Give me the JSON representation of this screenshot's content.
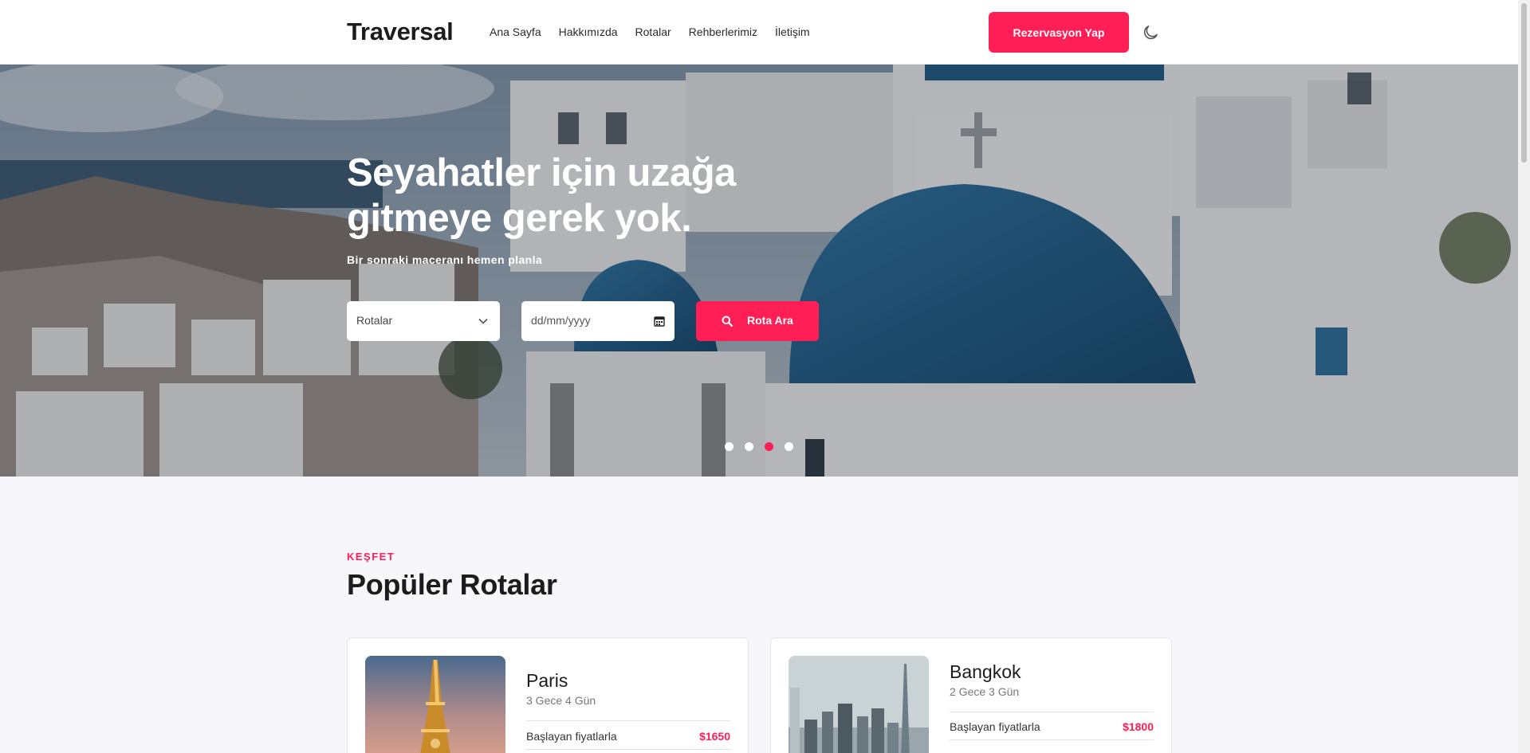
{
  "header": {
    "brand": "Traversal",
    "nav": [
      "Ana Sayfa",
      "Hakkımızda",
      "Rotalar",
      "Rehberlerimiz",
      "İletişim"
    ],
    "reserve_label": "Rezervasyon Yap",
    "theme_icon": "moon-icon"
  },
  "hero": {
    "title": "Seyahatler için uzağa gitmeye gerek yok.",
    "subtitle": "Bir sonraki maceranı hemen planla",
    "route_select_value": "Rotalar",
    "date_placeholder": "dd/mm/yyyy",
    "search_label": "Rota Ara",
    "carousel_dot_count": 4,
    "carousel_active_index": 2
  },
  "popular": {
    "kicker": "KEŞFET",
    "title": "Popüler Rotalar",
    "cards": [
      {
        "name": "Paris",
        "duration": "3 Gece 4 Gün",
        "price_label": "Başlayan fiyatlarla",
        "price": "$1650"
      },
      {
        "name": "Bangkok",
        "duration": "2 Gece 3 Gün",
        "price_label": "Başlayan fiyatlarla",
        "price": "$1800"
      }
    ]
  },
  "colors": {
    "accent": "#ff1e56",
    "background": "#f6f6fb",
    "dome_blue": "#1f5c86"
  }
}
